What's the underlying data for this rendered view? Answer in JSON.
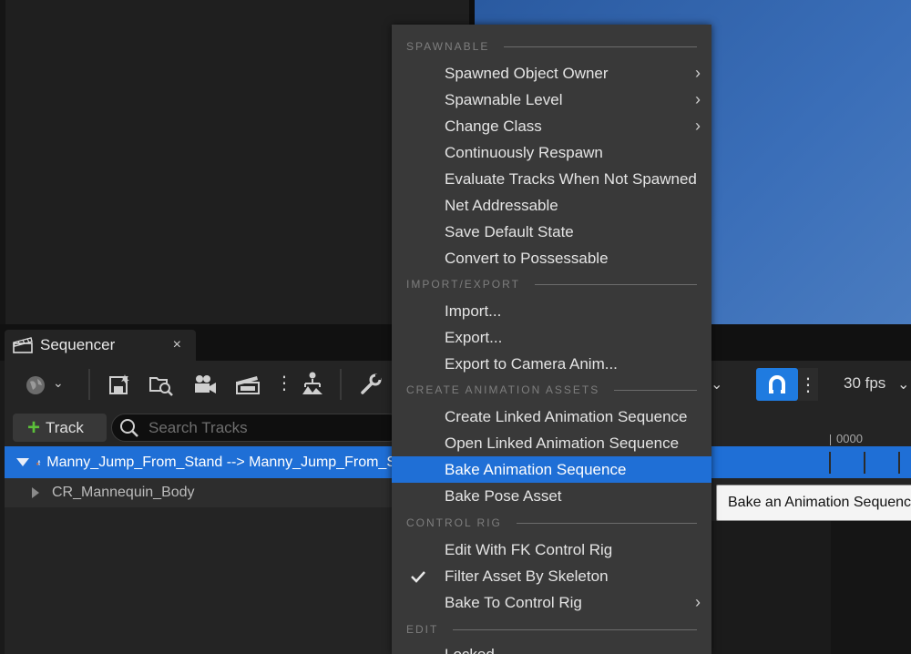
{
  "sequencer": {
    "tab_title": "Sequencer",
    "close_glyph": "×",
    "add_track_label": "Track",
    "search_placeholder": "Search Tracks",
    "fps_label": "30 fps",
    "frame_value": "0000",
    "tracks": [
      {
        "label": "Manny_Jump_From_Stand --> Manny_Jump_From_S",
        "selected": true,
        "expanded": true,
        "icon": "skeletal-mesh-actor-icon"
      },
      {
        "label": "CR_Mannequin_Body",
        "selected": false,
        "expanded": false
      }
    ]
  },
  "tooltip": {
    "text": "Bake an Animation Sequence"
  },
  "menu": {
    "sections": [
      {
        "title": "SPAWNABLE",
        "items": [
          {
            "label": "Spawned Object Owner",
            "submenu": true
          },
          {
            "label": "Spawnable Level",
            "submenu": true
          },
          {
            "label": "Change Class",
            "submenu": true
          },
          {
            "label": "Continuously Respawn"
          },
          {
            "label": "Evaluate Tracks When Not Spawned"
          },
          {
            "label": "Net Addressable"
          },
          {
            "label": "Save Default State"
          },
          {
            "label": "Convert to Possessable"
          }
        ]
      },
      {
        "title": "IMPORT/EXPORT",
        "items": [
          {
            "label": "Import..."
          },
          {
            "label": "Export..."
          },
          {
            "label": "Export to Camera Anim..."
          }
        ]
      },
      {
        "title": "CREATE ANIMATION ASSETS",
        "items": [
          {
            "label": "Create Linked Animation Sequence"
          },
          {
            "label": "Open Linked Animation Sequence"
          },
          {
            "label": "Bake Animation Sequence",
            "highlighted": true
          },
          {
            "label": "Bake Pose Asset"
          }
        ]
      },
      {
        "title": "CONTROL RIG",
        "items": [
          {
            "label": "Edit With FK Control Rig"
          },
          {
            "label": "Filter Asset By Skeleton",
            "checked": true
          },
          {
            "label": "Bake To Control Rig",
            "submenu": true
          }
        ]
      },
      {
        "title": "EDIT",
        "items": [
          {
            "label": "Locked"
          }
        ]
      }
    ],
    "submenu_glyph": "›"
  },
  "colors": {
    "accent": "#1f6fd6",
    "menu_bg": "#393939",
    "track_plus": "#5bbf3a"
  }
}
